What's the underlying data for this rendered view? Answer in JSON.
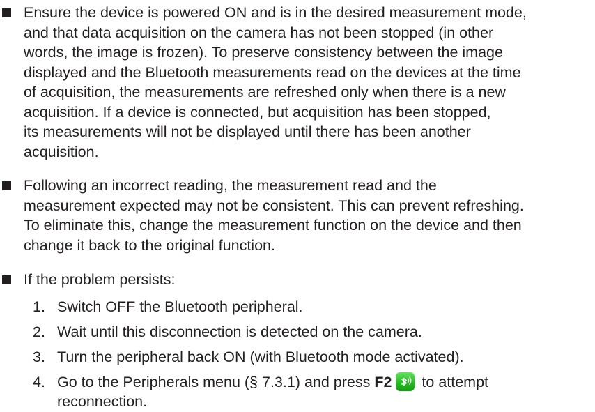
{
  "bullets": [
    {
      "lines": [
        "Ensure the device is powered ON and is in the desired measurement mode,",
        "and that data acquisition on the camera has not been stopped (in other",
        "words, the image is frozen). To preserve consistency between the image",
        "displayed and the Bluetooth measurements read on the devices at the time",
        "of acquisition, the measurements are refreshed only when there is a new",
        "acquisition. If a device is connected, but acquisition has been stopped,",
        "its measurements will not be displayed until there has been another",
        "acquisition."
      ]
    },
    {
      "lines": [
        "Following an incorrect reading, the measurement read and the",
        "measurement expected may not be consistent. This can prevent refreshing.",
        "To eliminate this, change the measurement function on the device and then",
        "change it back to the original function."
      ]
    },
    {
      "lines": [
        "If the problem persists:"
      ]
    }
  ],
  "steps": [
    {
      "number": "1.",
      "text": "Switch OFF the Bluetooth peripheral."
    },
    {
      "number": "2.",
      "text": "Wait until this disconnection is detected on the camera."
    },
    {
      "number": "3.",
      "text": "Turn the peripheral back ON (with Bluetooth mode activated)."
    },
    {
      "number": "4.",
      "text_before": "Go to the Peripherals menu (§ 7.3.1) and press ",
      "key": "F2",
      "text_after": " to attempt",
      "continuation": "reconnection.",
      "icon": "bluetooth-reconnect-icon"
    }
  ],
  "colors": {
    "text": "#231f20",
    "icon_green": "#23b81f"
  }
}
